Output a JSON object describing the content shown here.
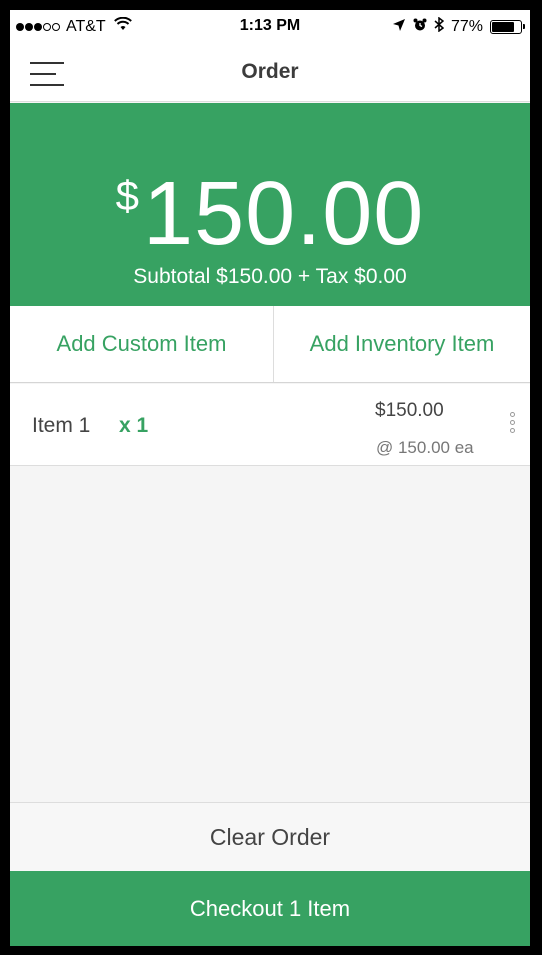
{
  "status_bar": {
    "carrier": "AT&T",
    "time": "1:13 PM",
    "battery_percent": "77%",
    "battery_level": 0.77,
    "signal_bars_filled": 3,
    "signal_bars_total": 5,
    "icons": [
      "wifi-icon",
      "location-arrow-icon",
      "alarm-icon",
      "bluetooth-icon",
      "battery-icon"
    ]
  },
  "nav": {
    "title": "Order",
    "menu_icon": "hamburger-menu-icon"
  },
  "total": {
    "currency_symbol": "$",
    "amount": "150.00",
    "subtotal_text": "Subtotal $150.00 + Tax $0.00"
  },
  "actions": {
    "add_custom": "Add Custom Item",
    "add_inventory": "Add Inventory Item"
  },
  "order_items": [
    {
      "name": "Item 1",
      "quantity": "x 1",
      "total": "$150.00",
      "unit_price": "@ 150.00 ea"
    }
  ],
  "footer": {
    "clear_label": "Clear Order",
    "checkout_label": "Checkout 1 Item"
  },
  "colors": {
    "accent_green": "#37a262",
    "background": "#f5f5f5"
  }
}
